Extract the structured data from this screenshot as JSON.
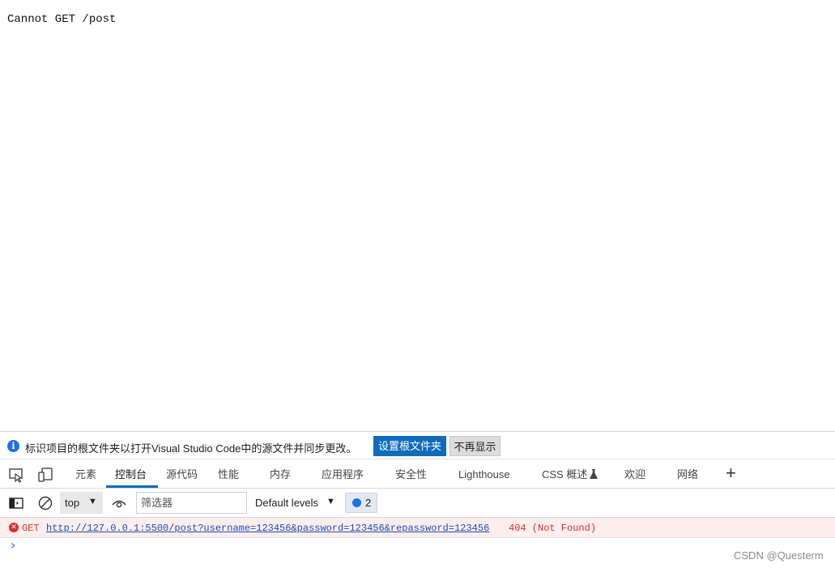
{
  "page": {
    "body_text": "Cannot GET /post"
  },
  "infobar": {
    "icon": "info-icon",
    "message": "标识项目的根文件夹以打开Visual Studio Code中的源文件并同步更改。",
    "primary_button": "设置根文件夹",
    "secondary_button": "不再显示"
  },
  "tabs": {
    "items": [
      {
        "label": "元素"
      },
      {
        "label": "控制台"
      },
      {
        "label": "源代码"
      },
      {
        "label": "性能"
      },
      {
        "label": "内存"
      },
      {
        "label": "应用程序"
      },
      {
        "label": "安全性"
      },
      {
        "label": "Lighthouse"
      },
      {
        "label": "CSS 概述"
      },
      {
        "label": "欢迎"
      },
      {
        "label": "网络"
      }
    ],
    "active": "控制台",
    "icons": [
      "inspect-element-icon",
      "device-emulation-icon",
      "flask-icon",
      "plus-icon"
    ]
  },
  "toolbar": {
    "icons": [
      "sidebar-toggle-icon",
      "clear-console-icon",
      "live-expression-eye-icon",
      "issues-icon"
    ],
    "context": "top",
    "filter_placeholder": "筛选器",
    "levels": "Default levels",
    "issues_count": "2"
  },
  "console": {
    "error": {
      "method": "GET",
      "url": "http://127.0.0.1:5500/post?username=123456&password=123456&repassword=123456",
      "status": "404 (Not Found)"
    },
    "prompt": "›"
  },
  "watermark": "CSDN @Questerm",
  "colors": {
    "accent": "#0f6cbd",
    "error": "#d93025",
    "link": "#1a4fb5",
    "error_bg": "#fdeeee"
  }
}
